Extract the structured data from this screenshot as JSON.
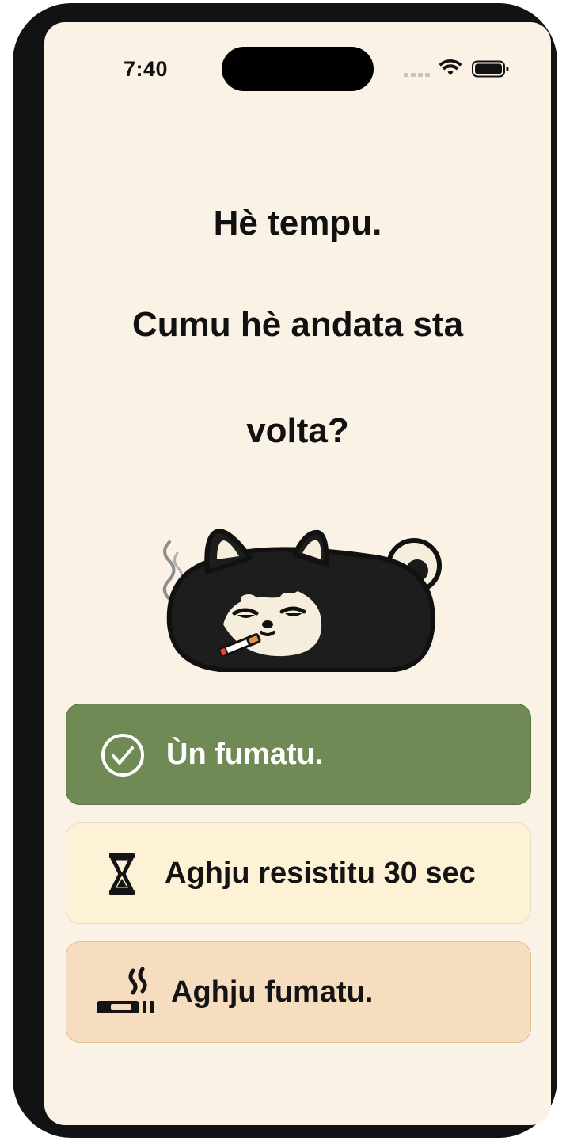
{
  "status_bar": {
    "time": "7:40",
    "icons": [
      "signal-icon",
      "wifi-icon",
      "battery-icon"
    ]
  },
  "question": {
    "line1": "Hè tempu.",
    "line2": "Cumu hè andata sta",
    "line3": "volta?"
  },
  "mascot": {
    "icon": "smoking-dog-mascot"
  },
  "options": [
    {
      "label": "Ùn fumatu.",
      "icon": "check-circle-icon",
      "color": "#6f8a55"
    },
    {
      "label": "Aghju resistitu 30 sec",
      "icon": "hourglass-icon",
      "color": "#fdf1d6"
    },
    {
      "label": "Aghju fumatu.",
      "icon": "cigarette-icon",
      "color": "#f6ddbf"
    }
  ],
  "colors": {
    "background": "#faf2e5",
    "text": "#111111"
  }
}
